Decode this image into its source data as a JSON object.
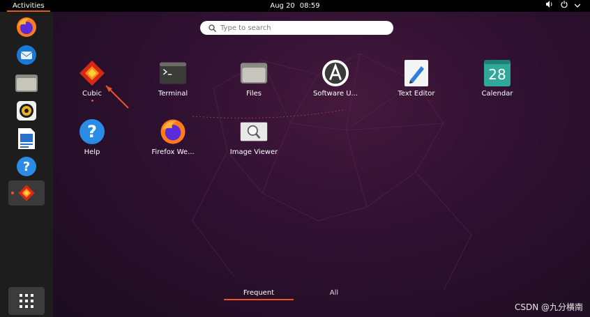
{
  "topbar": {
    "activities_label": "Activities",
    "date": "Aug 20",
    "time": "08:59"
  },
  "dock": {
    "items": [
      {
        "name": "firefox",
        "icon": "firefox-icon"
      },
      {
        "name": "thunderbird",
        "icon": "thunderbird-icon"
      },
      {
        "name": "files",
        "icon": "folder-icon"
      },
      {
        "name": "rhythmbox",
        "icon": "rhythmbox-icon"
      },
      {
        "name": "writer",
        "icon": "writer-icon"
      },
      {
        "name": "help",
        "icon": "help-icon"
      },
      {
        "name": "cubic",
        "icon": "cubic-icon",
        "active": true
      }
    ]
  },
  "search": {
    "placeholder": "Type to search"
  },
  "apps": [
    {
      "label": "Cubic",
      "icon": "cubic-icon",
      "running": true
    },
    {
      "label": "Terminal",
      "icon": "terminal-icon"
    },
    {
      "label": "Files",
      "icon": "folder-icon"
    },
    {
      "label": "Software U...",
      "icon": "software-icon"
    },
    {
      "label": "Text Editor",
      "icon": "text-editor-icon"
    },
    {
      "label": "Calendar",
      "icon": "calendar-icon",
      "day": "28"
    },
    {
      "label": "Help",
      "icon": "help-icon"
    },
    {
      "label": "Firefox We...",
      "icon": "firefox-icon"
    },
    {
      "label": "Image Viewer",
      "icon": "image-viewer-icon"
    }
  ],
  "tabs": {
    "frequent": "Frequent",
    "all": "All"
  },
  "watermark": "CSDN @九分横南",
  "colors": {
    "accent": "#e95420",
    "topbar": "#000000",
    "dock": "#1d1d1d"
  }
}
